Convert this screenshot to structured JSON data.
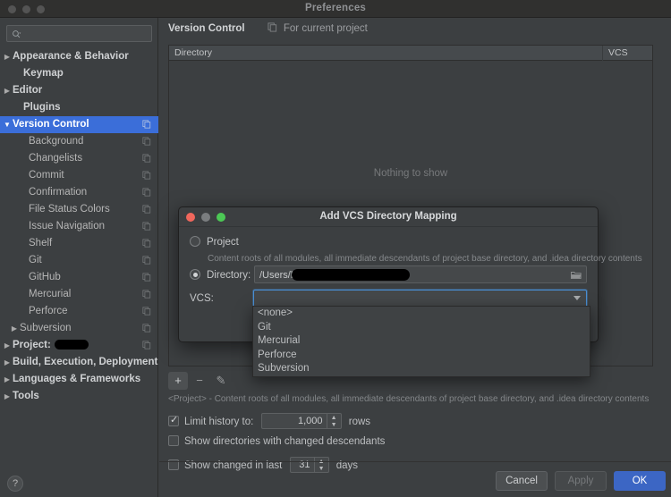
{
  "window": {
    "title": "Preferences",
    "traffic_lights": [
      "close-inactive",
      "minimize-inactive",
      "zoom-inactive"
    ]
  },
  "sidebar": {
    "search": {
      "placeholder": "",
      "value": "",
      "icon": "search-icon"
    },
    "items": [
      {
        "label": "Appearance & Behavior",
        "arrow": "▶",
        "indent": 14,
        "bold": true,
        "selected": false,
        "copy_icon": false
      },
      {
        "label": "Keymap",
        "arrow": "",
        "indent": 26,
        "bold": true,
        "selected": false,
        "copy_icon": false
      },
      {
        "label": "Editor",
        "arrow": "▶",
        "indent": 14,
        "bold": true,
        "selected": false,
        "copy_icon": false
      },
      {
        "label": "Plugins",
        "arrow": "",
        "indent": 26,
        "bold": true,
        "selected": false,
        "copy_icon": false
      },
      {
        "label": "Version Control",
        "arrow": "▼",
        "indent": 14,
        "bold": true,
        "selected": true,
        "copy_icon": true
      },
      {
        "label": "Background",
        "arrow": "",
        "indent": 32,
        "bold": false,
        "selected": false,
        "copy_icon": true
      },
      {
        "label": "Changelists",
        "arrow": "",
        "indent": 32,
        "bold": false,
        "selected": false,
        "copy_icon": true
      },
      {
        "label": "Commit",
        "arrow": "",
        "indent": 32,
        "bold": false,
        "selected": false,
        "copy_icon": true
      },
      {
        "label": "Confirmation",
        "arrow": "",
        "indent": 32,
        "bold": false,
        "selected": false,
        "copy_icon": true
      },
      {
        "label": "File Status Colors",
        "arrow": "",
        "indent": 32,
        "bold": false,
        "selected": false,
        "copy_icon": true
      },
      {
        "label": "Issue Navigation",
        "arrow": "",
        "indent": 32,
        "bold": false,
        "selected": false,
        "copy_icon": true
      },
      {
        "label": "Shelf",
        "arrow": "",
        "indent": 32,
        "bold": false,
        "selected": false,
        "copy_icon": true
      },
      {
        "label": "Git",
        "arrow": "",
        "indent": 32,
        "bold": false,
        "selected": false,
        "copy_icon": true
      },
      {
        "label": "GitHub",
        "arrow": "",
        "indent": 32,
        "bold": false,
        "selected": false,
        "copy_icon": true
      },
      {
        "label": "Mercurial",
        "arrow": "",
        "indent": 32,
        "bold": false,
        "selected": false,
        "copy_icon": true
      },
      {
        "label": "Perforce",
        "arrow": "",
        "indent": 32,
        "bold": false,
        "selected": false,
        "copy_icon": true
      },
      {
        "label": "Subversion",
        "arrow": "▶",
        "indent": 22,
        "bold": false,
        "selected": false,
        "copy_icon": true
      },
      {
        "label": "Project:",
        "arrow": "▶",
        "indent": 14,
        "bold": true,
        "selected": false,
        "copy_icon": true,
        "redacted_width": 38
      },
      {
        "label": "Build, Execution, Deployment",
        "arrow": "▶",
        "indent": 14,
        "bold": true,
        "selected": false,
        "copy_icon": false
      },
      {
        "label": "Languages & Frameworks",
        "arrow": "▶",
        "indent": 14,
        "bold": true,
        "selected": false,
        "copy_icon": false
      },
      {
        "label": "Tools",
        "arrow": "▶",
        "indent": 14,
        "bold": true,
        "selected": false,
        "copy_icon": false
      }
    ],
    "help_button": "?"
  },
  "main": {
    "title": "Version Control",
    "scope_label": "For current project",
    "scope_icon": "copy-icon",
    "table": {
      "columns": [
        "Directory",
        "VCS"
      ],
      "rows": [],
      "empty_message": "Nothing to show"
    },
    "toolbar": {
      "add": "+",
      "remove": "−",
      "edit": "✎"
    },
    "hint": "<Project> - Content roots of all modules, all immediate descendants of project base directory, and .idea directory contents",
    "options": [
      {
        "label": "Limit history to:",
        "checked": true,
        "value": "1,000",
        "suffix": "rows"
      },
      {
        "label": "Show directories with changed descendants",
        "checked": false
      },
      {
        "label": "Show changed in last",
        "checked": false,
        "value": "31",
        "suffix": "days"
      }
    ]
  },
  "footer": {
    "cancel": "Cancel",
    "apply": "Apply",
    "ok": "OK",
    "apply_disabled": true
  },
  "dialog": {
    "title": "Add VCS Directory Mapping",
    "traffic_lights": [
      "close",
      "minimize",
      "zoom"
    ],
    "project_option": {
      "label": "Project",
      "selected": false,
      "description": "Content roots of all modules, all immediate descendants of project base directory, and .idea directory contents"
    },
    "directory_option": {
      "label": "Directory:",
      "selected": true,
      "path_prefix": "/Users/l",
      "path_redacted": true,
      "browse_icon": "folder-icon"
    },
    "vcs_field": {
      "label": "VCS:",
      "value": "",
      "focused": true,
      "dropdown_open": true,
      "options": [
        "<none>",
        "Git",
        "Mercurial",
        "Perforce",
        "Subversion"
      ]
    }
  },
  "colors": {
    "accent_selection": "#3b6ed9",
    "primary_button": "#3c66c4",
    "focus_border": "#4a8fd4",
    "window_bg": "#3c3f41",
    "titlebar_bg": "#30302f"
  }
}
